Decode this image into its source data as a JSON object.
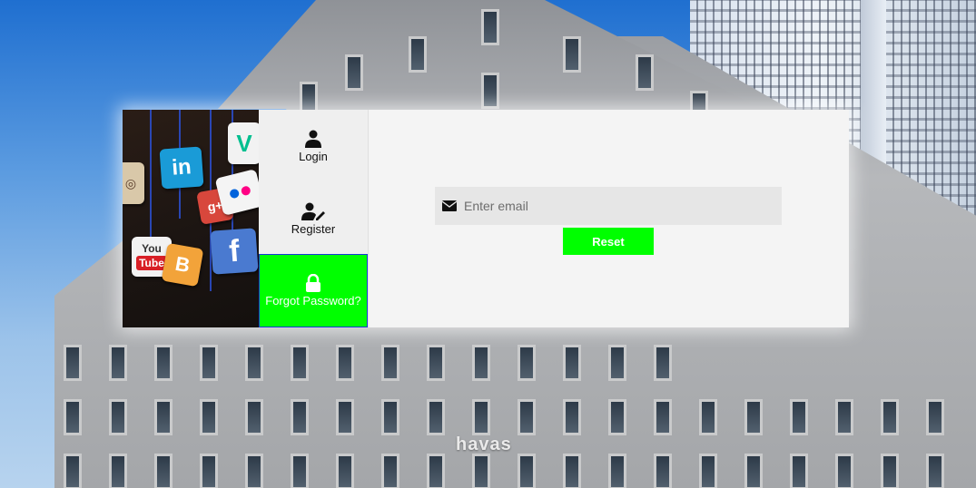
{
  "nav": {
    "login_label": "Login",
    "register_label": "Register",
    "forgot_label": "Forgot Password?",
    "login_icon": "user-icon",
    "register_icon": "user-edit-icon",
    "forgot_icon": "lock-icon"
  },
  "form": {
    "email_placeholder": "Enter email",
    "email_value": "",
    "email_icon": "envelope-icon",
    "reset_label": "Reset"
  },
  "background": {
    "sign_text": "havas"
  },
  "colors": {
    "accent": "#00ff00",
    "active_border": "#1838d8",
    "card_bg": "#f4f4f4",
    "input_bg": "#e6e6e6"
  }
}
